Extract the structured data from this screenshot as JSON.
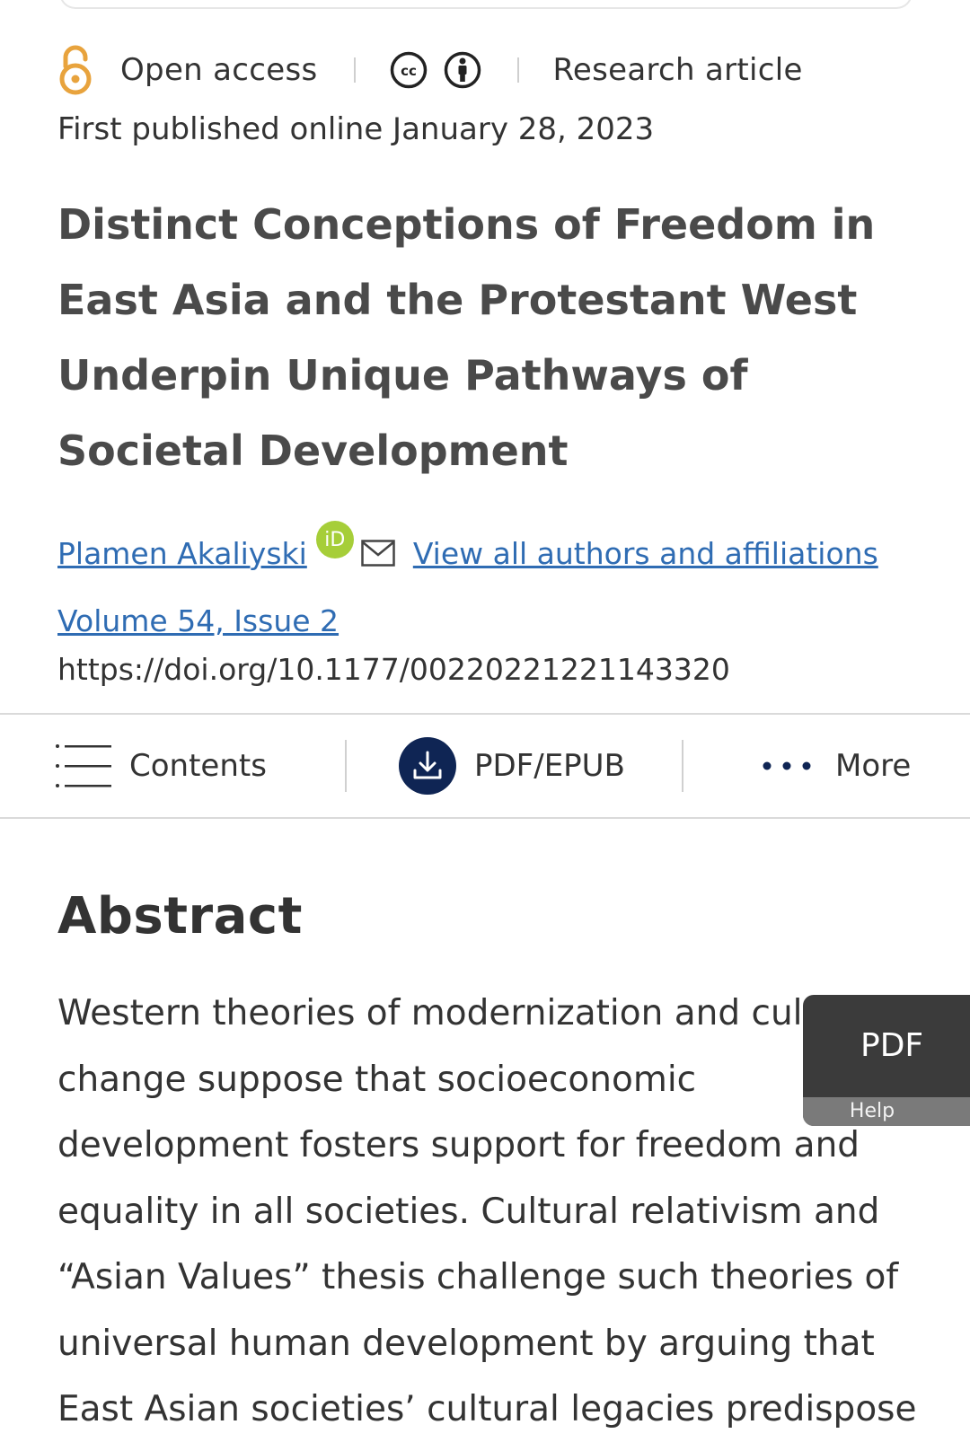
{
  "meta": {
    "open_access_label": "Open access",
    "article_type": "Research article",
    "published": "First published online January 28, 2023"
  },
  "article": {
    "title": "Distinct Conceptions of Freedom in East Asia and the Protestant West Underpin Unique Pathways of Societal Development",
    "author": "Plamen Akaliyski",
    "orcid_label": "iD",
    "all_authors_link": "View all authors and affiliations",
    "volume_issue": "Volume 54, Issue 2",
    "doi": "https://doi.org/10.1177/00220221221143320"
  },
  "toolbar": {
    "contents_label": "Contents",
    "pdf_epub_label": "PDF/EPUB",
    "more_label": "More"
  },
  "abstract": {
    "heading": "Abstract",
    "text": "Western theories of modernization and cultural change suppose that socioeconomic development fosters support for freedom and equality in all societies. Cultural relativism and “Asian Values” thesis challenge such theories of universal human development by arguing that East Asian societies’ cultural legacies predispose"
  },
  "floating_pdf": {
    "label": "PDF",
    "help_label": "Help"
  },
  "colors": {
    "open_access_orange": "#e8a33d",
    "link_blue": "#2f6cb3",
    "orcid_green": "#a6ce39",
    "download_navy": "#0f2554",
    "floating_panel": "#3b3b3b"
  },
  "icons": [
    "open-access-lock-icon",
    "cc-icon",
    "by-attribution-icon",
    "orcid-icon",
    "mail-icon",
    "contents-list-icon",
    "download-icon",
    "more-dots-icon"
  ]
}
